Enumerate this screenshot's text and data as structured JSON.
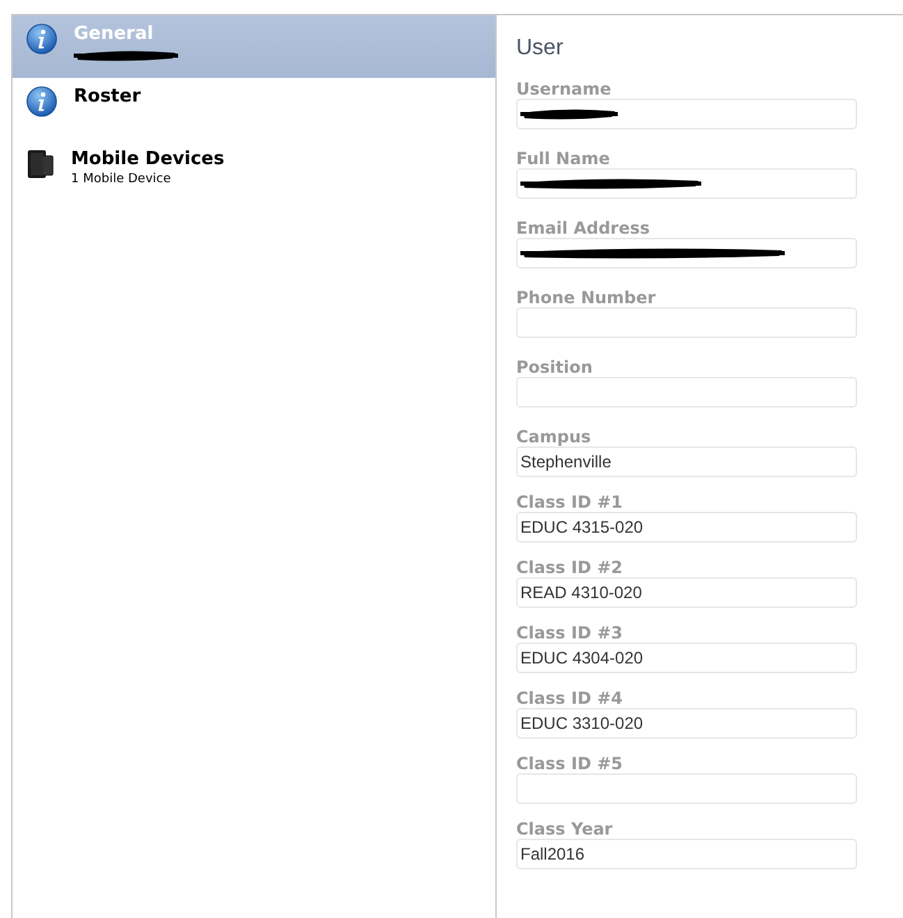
{
  "sidebar": {
    "items": [
      {
        "label": "General",
        "kind": "info",
        "selected": true,
        "subtitle_redacted": true
      },
      {
        "label": "Roster",
        "kind": "info",
        "selected": false
      },
      {
        "label": "Mobile Devices",
        "kind": "device",
        "selected": false,
        "subtitle": "1 Mobile Device"
      }
    ]
  },
  "panel": {
    "title": "User",
    "fields": [
      {
        "label": "Username",
        "redacted": true
      },
      {
        "label": "Full Name",
        "redacted": true
      },
      {
        "label": "Email Address",
        "redacted": true
      },
      {
        "label": "Phone Number"
      },
      {
        "label": "Position"
      },
      {
        "label": "Campus",
        "value": "Stephenville"
      },
      {
        "label": "Class ID #1",
        "value": "EDUC 4315-020"
      },
      {
        "label": "Class ID #2",
        "value": "READ 4310-020"
      },
      {
        "label": "Class ID #3",
        "value": "EDUC 4304-020"
      },
      {
        "label": "Class ID #4",
        "value": "EDUC 3310-020"
      },
      {
        "label": "Class ID #5"
      },
      {
        "label": "Class Year",
        "value": "Fall2016"
      }
    ]
  }
}
